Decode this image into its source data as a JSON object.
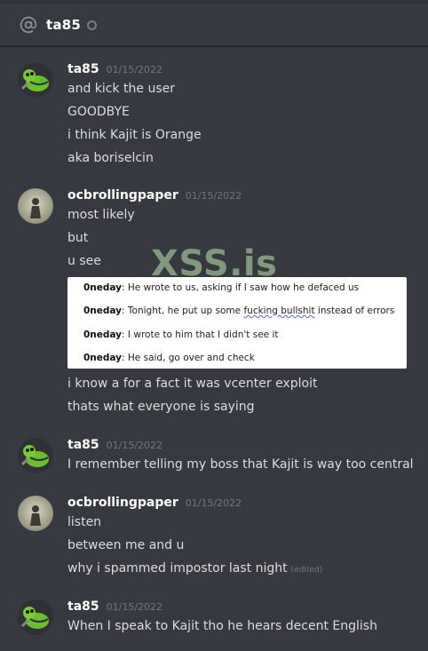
{
  "channel": {
    "name": "ta85"
  },
  "watermark": "XSS.is",
  "messages": [
    {
      "author": "ta85",
      "timestamp": "01/15/2022",
      "lines": [
        "and kick the user",
        "GOODBYE",
        "i think Kajit is Orange",
        "aka boriselcin"
      ]
    },
    {
      "author": "ocbrollingpaper",
      "timestamp": "01/15/2022",
      "lines": [
        "most likely",
        "but",
        "u see"
      ],
      "embed": [
        {
          "speaker": "0neday",
          "text": " He wrote to us, asking if I saw how he defaced us"
        },
        {
          "speaker": "0neday",
          "pre": " Tonight, he put up some ",
          "flagged": "fucking bullshit",
          "post": " instead of errors"
        },
        {
          "speaker": "0neday",
          "text": " I wrote to him that I didn't see it"
        },
        {
          "speaker": "0neday",
          "text": " He said, go over and check"
        }
      ],
      "after": [
        "i know a for a fact it was vcenter exploit",
        "thats what everyone is saying"
      ]
    },
    {
      "author": "ta85",
      "timestamp": "01/15/2022",
      "lines": [
        "I remember telling my boss that Kajit is way too central"
      ]
    },
    {
      "author": "ocbrollingpaper",
      "timestamp": "01/15/2022",
      "lines": [
        "listen",
        "between me and u",
        "why i spammed impostor last night"
      ],
      "edited": "(edited)"
    },
    {
      "author": "ta85",
      "timestamp": "01/15/2022",
      "lines": [
        "When I speak to Kajit tho he hears decent English"
      ]
    }
  ]
}
